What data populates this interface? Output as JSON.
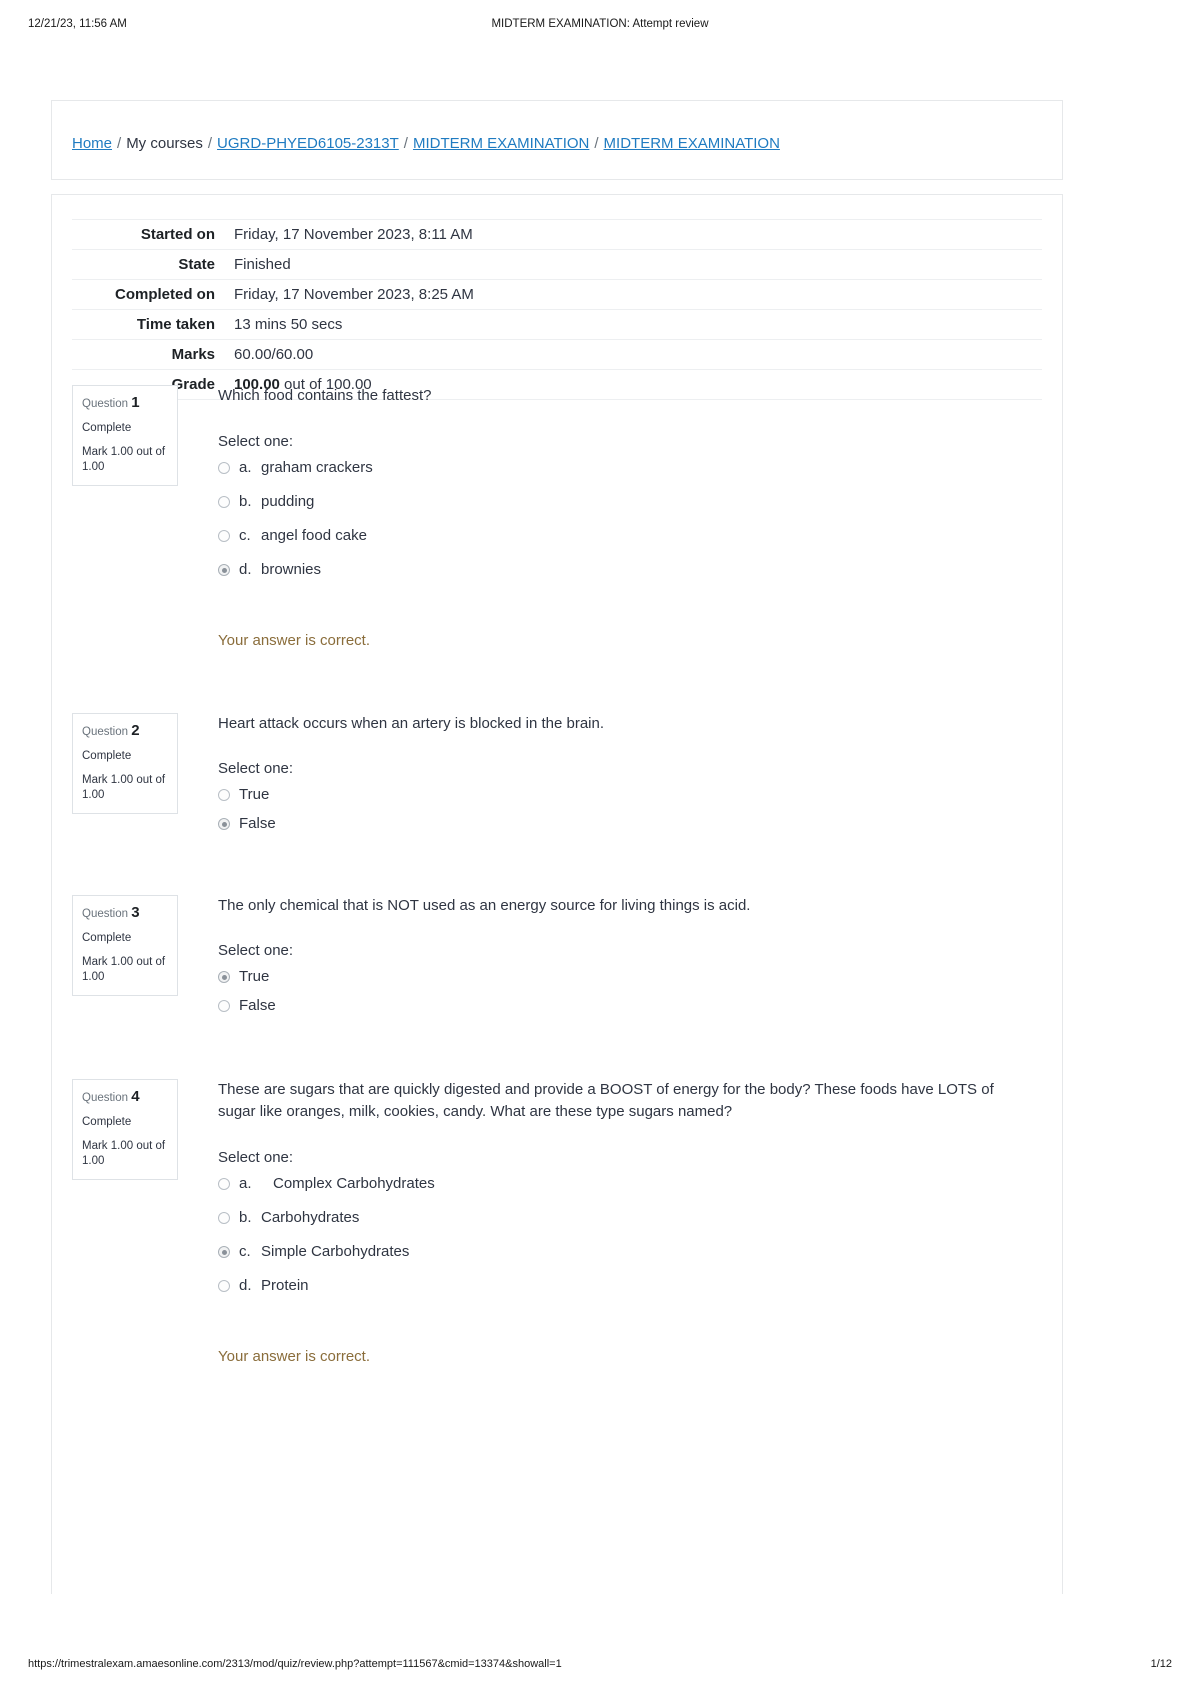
{
  "print_header": {
    "left": "12/21/23, 11:56 AM",
    "center": "MIDTERM EXAMINATION: Attempt review"
  },
  "print_footer": {
    "url": "https://trimestralexam.amaesonline.com/2313/mod/quiz/review.php?attempt=111567&cmid=13374&showall=1",
    "page": "1/12"
  },
  "breadcrumb": {
    "home": "Home",
    "my_courses": "My courses",
    "course": "UGRD-PHYED6105-2313T",
    "section": "MIDTERM EXAMINATION",
    "activity": "MIDTERM EXAMINATION",
    "separator": "/"
  },
  "summary": {
    "rows": [
      {
        "label": "Started on",
        "value": "Friday, 17 November 2023, 8:11 AM"
      },
      {
        "label": "State",
        "value": "Finished"
      },
      {
        "label": "Completed on",
        "value": "Friday, 17 November 2023, 8:25 AM"
      },
      {
        "label": "Time taken",
        "value": "13 mins 50 secs"
      },
      {
        "label": "Marks",
        "value": "60.00/60.00"
      }
    ],
    "grade_label": "Grade",
    "grade_value_bold": "100.00",
    "grade_value_rest": " out of 100.00"
  },
  "questions": [
    {
      "info": {
        "question_word": "Question",
        "number": "1",
        "state": "Complete",
        "mark": "Mark 1.00 out of 1.00"
      },
      "text": "Which food contains the fattest?",
      "select_one": "Select one:",
      "options": [
        {
          "letter": "a.",
          "label": "graham crackers",
          "selected": false
        },
        {
          "letter": "b.",
          "label": "pudding",
          "selected": false
        },
        {
          "letter": "c.",
          "label": "angel food cake",
          "selected": false
        },
        {
          "letter": "d.",
          "label": "brownies",
          "selected": true
        }
      ],
      "feedback": "Your answer is correct."
    },
    {
      "info": {
        "question_word": "Question",
        "number": "2",
        "state": "Complete",
        "mark": "Mark 1.00 out of 1.00"
      },
      "text": "Heart attack occurs when an artery is blocked in the brain.",
      "select_one": "Select one:",
      "options": [
        {
          "letter": "",
          "label": "True",
          "selected": false
        },
        {
          "letter": "",
          "label": "False",
          "selected": true
        }
      ],
      "feedback": ""
    },
    {
      "info": {
        "question_word": "Question",
        "number": "3",
        "state": "Complete",
        "mark": "Mark 1.00 out of 1.00"
      },
      "text": "The only chemical that is NOT used as an energy source for living things is acid.",
      "select_one": "Select one:",
      "options": [
        {
          "letter": "",
          "label": "True",
          "selected": true
        },
        {
          "letter": "",
          "label": "False",
          "selected": false
        }
      ],
      "feedback": ""
    },
    {
      "info": {
        "question_word": "Question",
        "number": "4",
        "state": "Complete",
        "mark": "Mark 1.00 out of 1.00"
      },
      "text": "These are sugars that are quickly digested and provide a BOOST of energy for the body? These foods have LOTS of sugar like oranges, milk, cookies, candy. What are these type sugars named?",
      "select_one": "Select one:",
      "options": [
        {
          "letter": "a.",
          "label": "Complex Carbohydrates",
          "selected": false
        },
        {
          "letter": "b.",
          "label": "Carbohydrates",
          "selected": false
        },
        {
          "letter": "c.",
          "label": "Simple Carbohydrates",
          "selected": true
        },
        {
          "letter": "d.",
          "label": "Protein",
          "selected": false
        }
      ],
      "feedback": "Your answer is correct."
    }
  ],
  "colors": {
    "link": "#1f7bc1",
    "feedback": "#8a6d3b",
    "text": "#2f3542",
    "border": "#e6e8ea"
  }
}
